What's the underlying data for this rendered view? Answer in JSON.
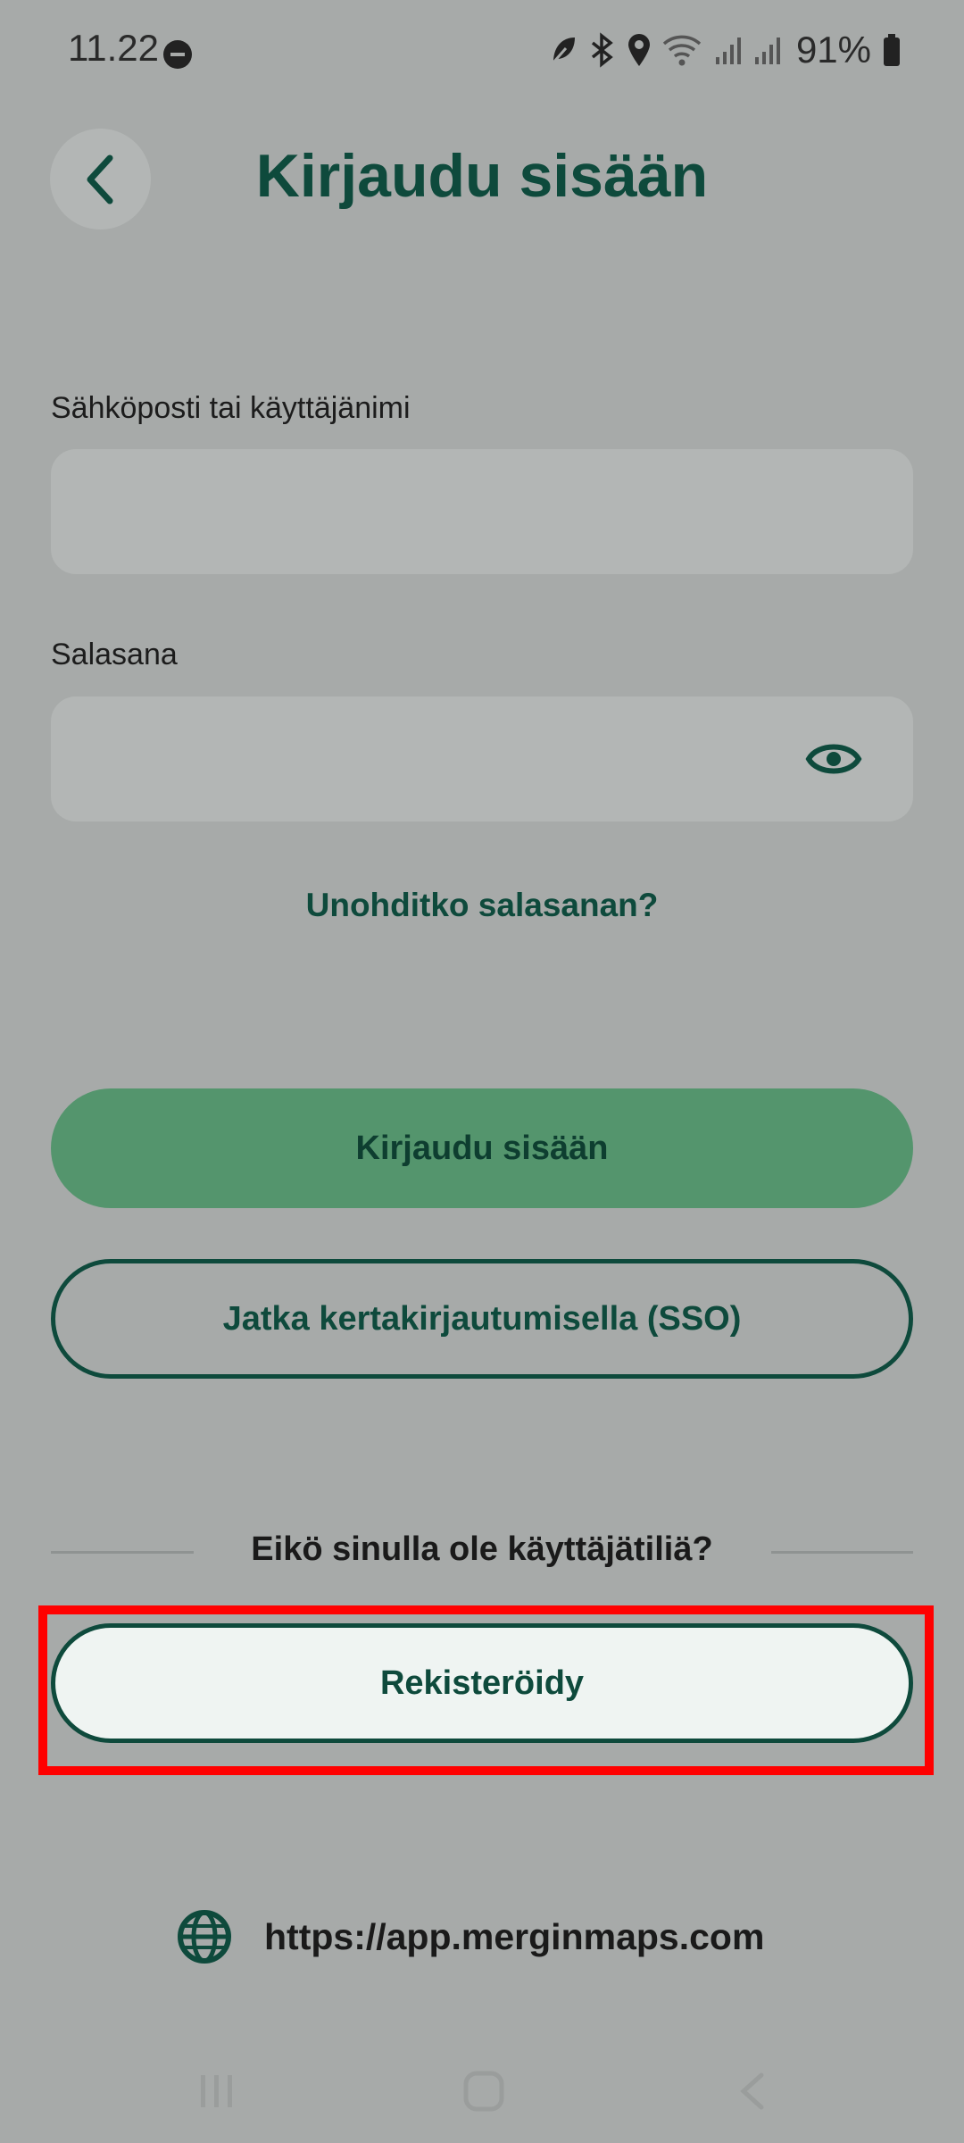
{
  "status_bar": {
    "time": "11.22",
    "battery": "91%",
    "icons": [
      "do-not-disturb-icon",
      "leaf-icon",
      "bluetooth-icon",
      "location-icon",
      "wifi-icon",
      "signal-icon",
      "signal-icon",
      "battery-icon"
    ]
  },
  "header": {
    "title": "Kirjaudu sisään",
    "back_icon": "chevron-left-icon"
  },
  "form": {
    "username_label": "Sähköposti tai käyttäjänimi",
    "username_value": "",
    "password_label": "Salasana",
    "password_value": "",
    "password_toggle_icon": "eye-icon",
    "forgot_password": "Unohditko salasanan?"
  },
  "actions": {
    "login_label": "Kirjaudu sisään",
    "sso_label": "Jatka kertakirjautumisella (SSO)",
    "no_account_text": "Eikö sinulla ole käyttäjätiliä?",
    "register_label": "Rekisteröidy"
  },
  "footer": {
    "url": "https://app.merginmaps.com",
    "url_icon": "globe-icon"
  },
  "colors": {
    "accent": "#0e4a3c",
    "primary_button": "#54956d",
    "background": "#a7aaa9",
    "highlight": "#ff0000"
  }
}
